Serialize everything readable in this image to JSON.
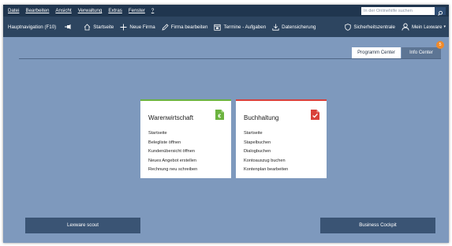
{
  "menu": {
    "items": [
      "Datei",
      "Bearbeiten",
      "Ansicht",
      "Verwaltung",
      "Extras",
      "Fenster",
      "?"
    ]
  },
  "help_search": {
    "placeholder": "In der Onlinehilfe suchen"
  },
  "toolbar": {
    "nav_label": "Hauptnavigation (F10)",
    "startseite": "Startseite",
    "neue_firma": "Neue Firma",
    "firma_bearbeiten": "Firma bearbeiten",
    "termine": "Termine - Aufgaben",
    "datensicherung": "Datensicherung",
    "sicherheitszentrale": "Sicherheitszentrale",
    "account": "Mein Lexware",
    "account_caret": "▾"
  },
  "tabs": {
    "programm_center": "Programm Center",
    "info_center": "Info Center",
    "info_badge": "5"
  },
  "cards": {
    "warenwirtschaft": {
      "title": "Warenwirtschaft",
      "accent": "#6cb33f",
      "icon": "document-euro-icon",
      "items": [
        "Startseite",
        "Belegliste öffnen",
        "Kundenübersicht öffnen",
        "Neues Angebot erstellen",
        "Rechnung neu schreiben"
      ]
    },
    "buchhaltung": {
      "title": "Buchhaltung",
      "accent": "#d9403a",
      "icon": "document-check-icon",
      "items": [
        "Startseite",
        "Stapelbuchen",
        "Dialogbuchen",
        "Kontoauszug buchen",
        "Kontenplan bearbeiten"
      ]
    }
  },
  "bottom": {
    "scout": "Lexware scout",
    "cockpit": "Business Cockpit"
  },
  "colors": {
    "menubar": "#20364f",
    "toolbar": "#2d4560",
    "background": "#7e99bd",
    "button": "#3a5474",
    "badge": "#f08a2a"
  }
}
